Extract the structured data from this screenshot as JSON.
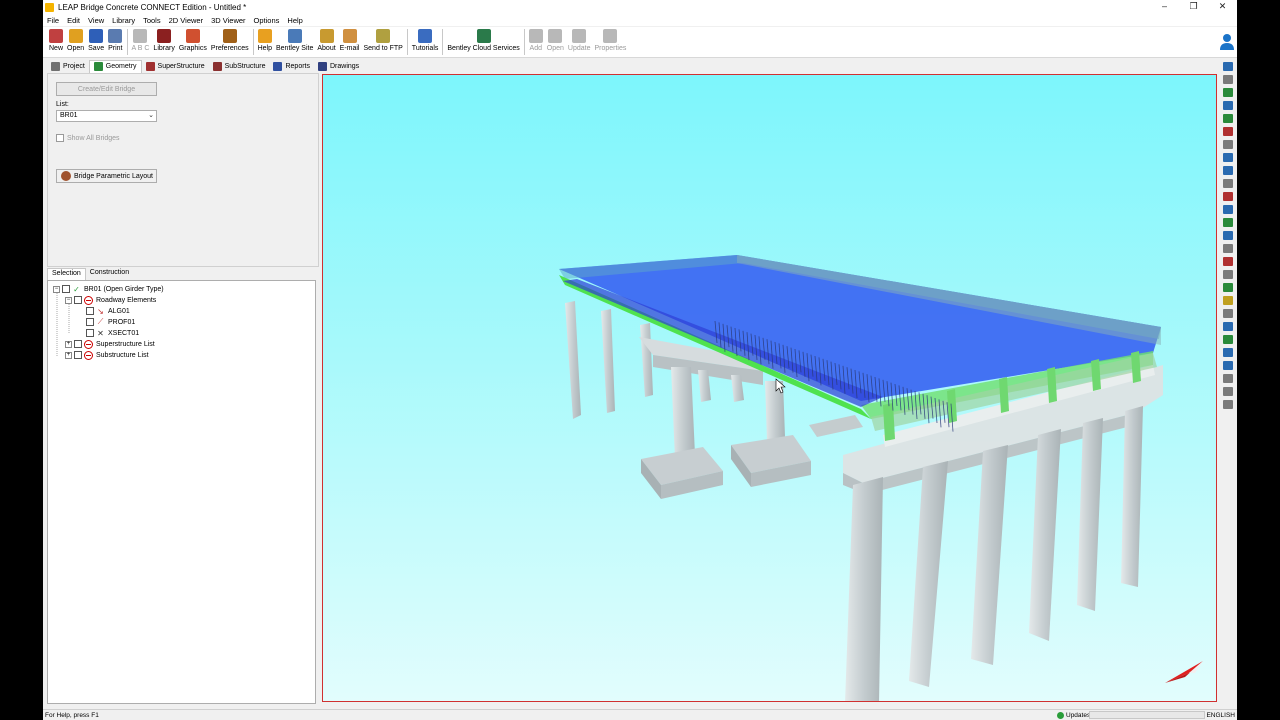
{
  "window": {
    "title": "LEAP Bridge Concrete CONNECT Edition - Untitled *",
    "controls": [
      "–",
      "❐",
      "✕"
    ]
  },
  "menu": [
    "File",
    "Edit",
    "View",
    "Library",
    "Tools",
    "2D Viewer",
    "3D Viewer",
    "Options",
    "Help"
  ],
  "toolbar": {
    "groups": [
      [
        {
          "label": "New",
          "icon": "new-file-icon",
          "color": "#c04040"
        },
        {
          "label": "Open",
          "icon": "open-folder-icon",
          "color": "#e0a020"
        },
        {
          "label": "Save",
          "icon": "save-icon",
          "color": "#2e5fb8"
        },
        {
          "label": "Print",
          "icon": "print-icon",
          "color": "#5a7bb0"
        }
      ],
      [
        {
          "label": "A B C",
          "icon": "spellcheck-icon",
          "color": "#9a9a9a",
          "disabled": true
        },
        {
          "label": "Library",
          "icon": "library-icon",
          "color": "#8b2020"
        },
        {
          "label": "Graphics",
          "icon": "graphics-icon",
          "color": "#d05030"
        },
        {
          "label": "Preferences",
          "icon": "preferences-gear-icon",
          "color": "#a06018"
        }
      ],
      [
        {
          "label": "Help",
          "icon": "help-icon",
          "color": "#e8a020"
        },
        {
          "label": "Bentley Site",
          "icon": "bentley-site-icon",
          "color": "#4a7ab8"
        },
        {
          "label": "About",
          "icon": "about-icon",
          "color": "#c89a30"
        },
        {
          "label": "E-mail",
          "icon": "email-icon",
          "color": "#d09040"
        },
        {
          "label": "Send to FTP",
          "icon": "ftp-icon",
          "color": "#b0a040"
        }
      ],
      [
        {
          "label": "Tutorials",
          "icon": "tutorials-icon",
          "color": "#3a6cc0"
        }
      ],
      [
        {
          "label": "Bentley Cloud Services",
          "icon": "cloud-services-icon",
          "color": "#2a7a4a"
        }
      ],
      [
        {
          "label": "Add",
          "icon": "add-icon",
          "color": "#9a9a9a",
          "disabled": true
        },
        {
          "label": "Open",
          "icon": "open-icon",
          "color": "#9a9a9a",
          "disabled": true
        },
        {
          "label": "Update",
          "icon": "update-icon",
          "color": "#9a9a9a",
          "disabled": true
        },
        {
          "label": "Properties",
          "icon": "properties-icon",
          "color": "#9a9a9a",
          "disabled": true
        }
      ]
    ]
  },
  "tabs": [
    {
      "label": "Project",
      "icon": "project-icon",
      "color": "#707070"
    },
    {
      "label": "Geometry",
      "icon": "geometry-icon",
      "color": "#2a8a3a",
      "active": true
    },
    {
      "label": "SuperStructure",
      "icon": "superstructure-icon",
      "color": "#a03030"
    },
    {
      "label": "SubStructure",
      "icon": "substructure-icon",
      "color": "#8a3030"
    },
    {
      "label": "Reports",
      "icon": "reports-icon",
      "color": "#3050a0"
    },
    {
      "label": "Drawings",
      "icon": "drawings-icon",
      "color": "#304080"
    }
  ],
  "geometry_panel": {
    "create_button": "Create/Edit Bridge",
    "list_label": "List:",
    "list_value": "BR01",
    "show_all": "Show All Bridges",
    "parametric_button": "Bridge Parametric Layout"
  },
  "subtabs": [
    "Selection",
    "Construction"
  ],
  "tree": {
    "root": "BR01 (Open Girder Type)",
    "roadway": "Roadway Elements",
    "alignment": "ALG01",
    "profile": "PROF01",
    "xsection": "XSECT01",
    "superstructure": "Superstructure List",
    "substructure": "Substructure List"
  },
  "status": {
    "help": "For Help, press F1",
    "updates": "Updates",
    "language": "ENGLISH"
  },
  "colors": {
    "viewport_sky_top": "#7df6fc",
    "viewport_border": "#d03030",
    "deck": "#3b67f2",
    "girders": "#4fe24f",
    "concrete": "#cfd6d8"
  }
}
